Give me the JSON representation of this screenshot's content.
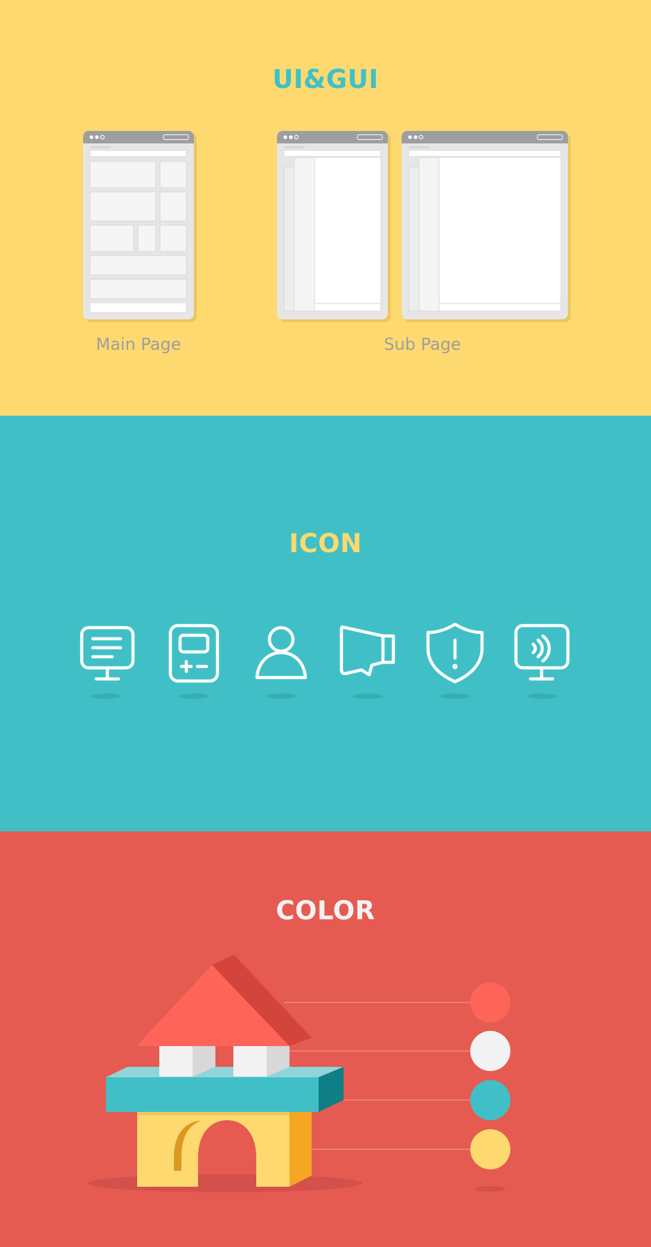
{
  "colors": {
    "yellow": "#FDD96F",
    "teal": "#40C0C6",
    "red": "#E55B51",
    "ui_title": "#40C0C6",
    "icon_title": "#FDD96F",
    "color_title": "#F2F2F2",
    "label_gray": "#9E9E9E",
    "window_bar": "#9E9D9F",
    "swatch_red": "#FF6459",
    "swatch_white": "#F2F2F2",
    "swatch_teal": "#40C0C6",
    "swatch_yellow": "#FDD96F"
  },
  "ui_section": {
    "title": "UI&GUI",
    "mockups": [
      {
        "kind": "main",
        "label": "Main Page"
      },
      {
        "kind": "sub",
        "label": "Sub Page"
      }
    ]
  },
  "icon_section": {
    "title": "ICON",
    "icons": [
      "message-monitor-icon",
      "calculator-icon",
      "user-icon",
      "megaphone-icon",
      "shield-alert-icon",
      "broadcast-monitor-icon"
    ]
  },
  "color_section": {
    "title": "COLOR",
    "swatches": [
      "#FF6459",
      "#F2F2F2",
      "#40C0C6",
      "#FDD96F"
    ]
  }
}
